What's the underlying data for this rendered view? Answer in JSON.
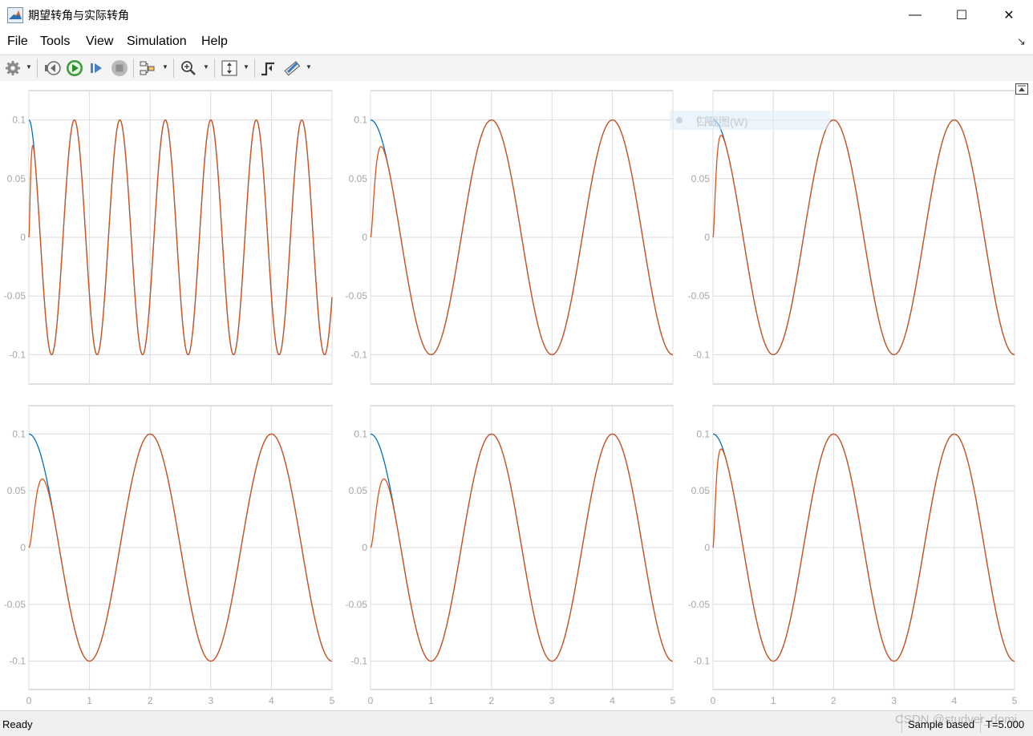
{
  "window": {
    "title": "期望转角与实际转角",
    "icon": "matlab-icon",
    "controls": {
      "minimize": "—",
      "maximize": "☐",
      "close": "✕"
    }
  },
  "menu": {
    "items": [
      "File",
      "Tools",
      "View",
      "Simulation",
      "Help"
    ],
    "overflow": "↘"
  },
  "toolbar": {
    "buttons": [
      "settings",
      "step-back",
      "run",
      "step-forward",
      "stop",
      "highlight-signal",
      "zoom",
      "scale-axes",
      "triggers",
      "measurements"
    ]
  },
  "colors": {
    "desired": "#0072BD",
    "actual": "#D95319",
    "grid": "#dcdcdc",
    "axis": "#bfbfbf",
    "tick_label": "#a6a6a6"
  },
  "tooltip": {
    "text": "口截图(W)"
  },
  "status": {
    "left": "Ready",
    "mode": "Sample based",
    "time": "T=5.000"
  },
  "watermark": "CSDN @studyer_domi",
  "chart_data": [
    {
      "type": "line",
      "position": "top-left",
      "xlim": [
        0,
        5
      ],
      "ylim": [
        -0.125,
        0.125
      ],
      "xticks": [
        0,
        1,
        2,
        3,
        4,
        5
      ],
      "xticklabels": [
        "",
        "",
        "",
        "",
        "",
        ""
      ],
      "yticks": [
        0.1,
        0.05,
        0,
        -0.05,
        -0.1
      ],
      "yticklabels": [
        "0.1",
        "0.05",
        "0",
        "-0.05",
        "-0.1"
      ],
      "grid": true,
      "series": [
        {
          "role": "desired",
          "formula": "0.1*cos(2*pi*f*t)",
          "frequency": 1.333
        },
        {
          "role": "actual",
          "follows": "desired",
          "converge_time": 0.08,
          "initial": 0,
          "first_peak": 0.09
        }
      ]
    },
    {
      "type": "line",
      "position": "top-middle",
      "xlim": [
        0,
        5
      ],
      "ylim": [
        -0.125,
        0.125
      ],
      "xticks": [
        0,
        1,
        2,
        3,
        4,
        5
      ],
      "xticklabels": [
        "",
        "",
        "",
        "",
        "",
        ""
      ],
      "yticks": [
        0.1,
        0.05,
        0,
        -0.05,
        -0.1
      ],
      "yticklabels": [
        "0.1",
        "0.05",
        "0",
        "-0.05",
        "-0.1"
      ],
      "grid": true,
      "series": [
        {
          "role": "desired",
          "formula": "0.1*cos(2*pi*f*t)",
          "frequency": 0.5
        },
        {
          "role": "actual",
          "follows": "desired",
          "converge_time": 0.22,
          "initial": 0,
          "first_peak": 0.085
        }
      ]
    },
    {
      "type": "line",
      "position": "top-right",
      "xlim": [
        0,
        5
      ],
      "ylim": [
        -0.125,
        0.125
      ],
      "xticks": [
        0,
        1,
        2,
        3,
        4,
        5
      ],
      "xticklabels": [
        "",
        "",
        "",
        "",
        "",
        ""
      ],
      "yticks": [
        0.1,
        0.05,
        0,
        -0.05,
        -0.1
      ],
      "yticklabels": [
        "0.1",
        "0.05",
        "0",
        "-0.05",
        "-0.1"
      ],
      "grid": true,
      "series": [
        {
          "role": "desired",
          "formula": "0.1*cos(2*pi*f*t)",
          "frequency": 0.5
        },
        {
          "role": "actual",
          "follows": "desired",
          "converge_time": 0.14,
          "initial": 0,
          "first_peak": 0.09
        }
      ]
    },
    {
      "type": "line",
      "position": "bottom-left",
      "xlim": [
        0,
        5
      ],
      "ylim": [
        -0.125,
        0.125
      ],
      "xticks": [
        0,
        1,
        2,
        3,
        4,
        5
      ],
      "xticklabels": [
        "0",
        "1",
        "2",
        "3",
        "4",
        "5"
      ],
      "yticks": [
        0.1,
        0.05,
        0,
        -0.05,
        -0.1
      ],
      "yticklabels": [
        "0.1",
        "0.05",
        "0",
        "-0.05",
        "-0.1"
      ],
      "grid": true,
      "series": [
        {
          "role": "desired",
          "formula": "0.1*cos(2*pi*f*t)",
          "frequency": 0.5
        },
        {
          "role": "actual",
          "follows": "desired",
          "converge_time": 0.38,
          "initial": 0,
          "first_peak": 0.07
        }
      ]
    },
    {
      "type": "line",
      "position": "bottom-middle",
      "xlim": [
        0,
        5
      ],
      "ylim": [
        -0.125,
        0.125
      ],
      "xticks": [
        0,
        1,
        2,
        3,
        4,
        5
      ],
      "xticklabels": [
        "0",
        "1",
        "2",
        "3",
        "4",
        "5"
      ],
      "yticks": [
        0.1,
        0.05,
        0,
        -0.05,
        -0.1
      ],
      "yticklabels": [
        "0.1",
        "0.05",
        "0",
        "-0.05",
        "-0.1"
      ],
      "grid": true,
      "series": [
        {
          "role": "desired",
          "formula": "0.1*cos(2*pi*f*t)",
          "frequency": 0.5
        },
        {
          "role": "actual",
          "follows": "desired",
          "converge_time": 0.38,
          "initial": 0,
          "first_peak": 0.069
        }
      ]
    },
    {
      "type": "line",
      "position": "bottom-right",
      "xlim": [
        0,
        5
      ],
      "ylim": [
        -0.125,
        0.125
      ],
      "xticks": [
        0,
        1,
        2,
        3,
        4,
        5
      ],
      "xticklabels": [
        "0",
        "1",
        "2",
        "3",
        "4",
        "5"
      ],
      "yticks": [
        0.1,
        0.05,
        0,
        -0.05,
        -0.1
      ],
      "yticklabels": [
        "0.1",
        "0.05",
        "0",
        "-0.05",
        "-0.1"
      ],
      "grid": true,
      "series": [
        {
          "role": "desired",
          "formula": "0.1*cos(2*pi*f*t)",
          "frequency": 0.5
        },
        {
          "role": "actual",
          "follows": "desired",
          "converge_time": 0.14,
          "initial": 0,
          "first_peak": 0.09
        }
      ]
    }
  ]
}
